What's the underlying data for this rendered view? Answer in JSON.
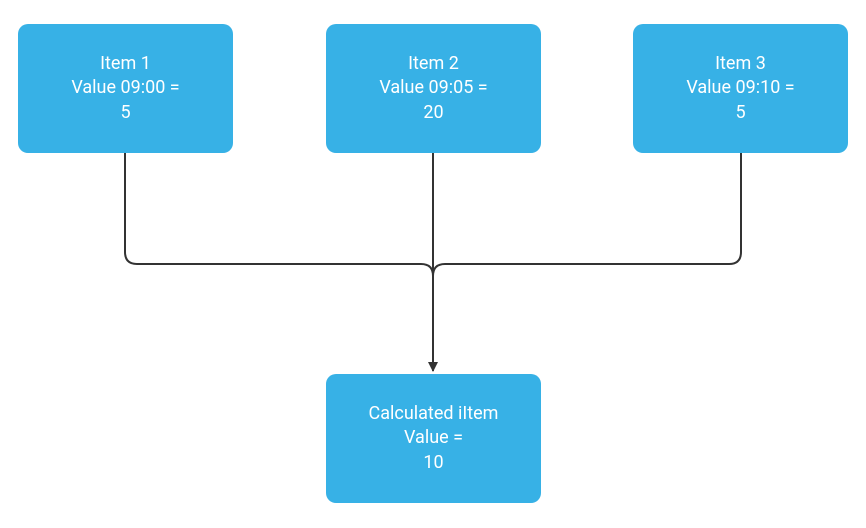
{
  "colors": {
    "node_fill": "#37b1e6",
    "node_text": "#ffffff",
    "connector": "#333333"
  },
  "nodes": {
    "item1": {
      "line1": "Item 1",
      "line2": "Value 09:00 =",
      "line3": "5"
    },
    "item2": {
      "line1": "Item 2",
      "line2": "Value 09:05 =",
      "line3": "20"
    },
    "item3": {
      "line1": "Item 3",
      "line2": "Value 09:10 =",
      "line3": "5"
    },
    "result": {
      "line1": "Calculated iItem",
      "line2": "Value =",
      "line3": "10"
    }
  }
}
